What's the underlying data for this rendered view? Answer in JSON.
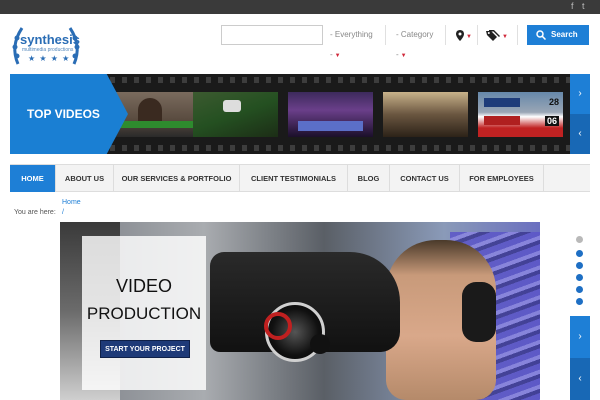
{
  "social": {
    "facebook": "f",
    "twitter": "t"
  },
  "logo": {
    "name": "synthesis",
    "tagline": "multimedia productions",
    "stars": "★ ★ ★ ★"
  },
  "search": {
    "input_value": "",
    "everything_label": "- Everything -",
    "category_label": "- Category -",
    "button_label": "Search"
  },
  "top_videos": {
    "label": "TOP VIDEOS"
  },
  "scoreboard": {
    "top_score": "28",
    "bottom_score": "06"
  },
  "nav": {
    "items": [
      {
        "label": "HOME",
        "active": true
      },
      {
        "label": "ABOUT US"
      },
      {
        "label": "OUR SERVICES & PORTFOLIO"
      },
      {
        "label": "CLIENT TESTIMONIALS"
      },
      {
        "label": "BLOG"
      },
      {
        "label": "CONTACT US"
      },
      {
        "label": "FOR EMPLOYEES"
      }
    ]
  },
  "breadcrumb": {
    "home": "Home",
    "you_are_here": "You are here:",
    "separator": "/"
  },
  "hero": {
    "title_line1": "VIDEO",
    "title_line2": "PRODUCTION",
    "cta_label": "START YOUR PROJECT"
  },
  "colors": {
    "accent": "#1e7fd6",
    "cta": "#1e3a78",
    "topbar": "#3a3a3a"
  }
}
